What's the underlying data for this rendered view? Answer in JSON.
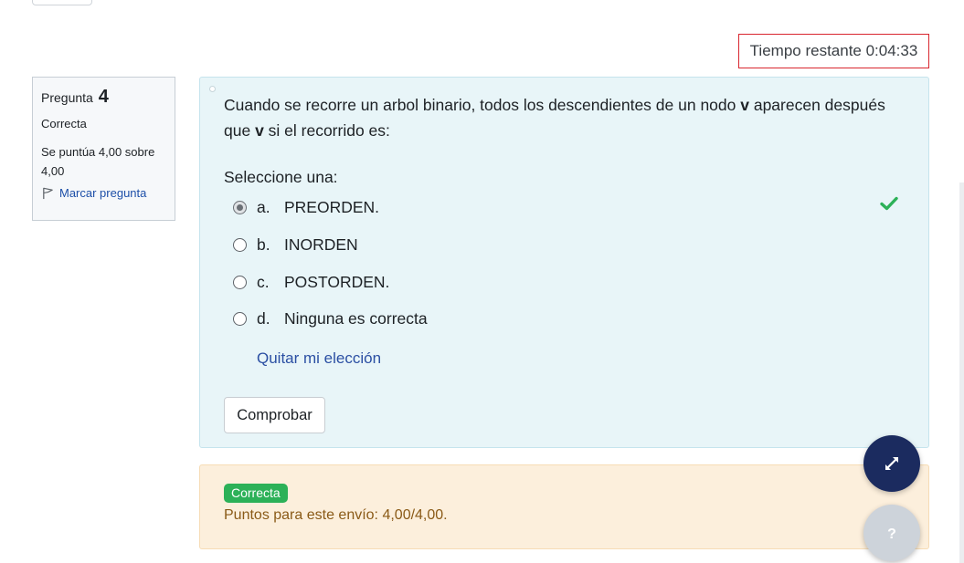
{
  "timer": {
    "label": "Tiempo restante 0:04:33"
  },
  "info": {
    "question_label": "Pregunta",
    "question_number": "4",
    "state": "Correcta",
    "grade_line1": "Se puntúa 4,00 sobre",
    "grade_line2": "4,00",
    "flag_label": "Marcar pregunta"
  },
  "question": {
    "text_part1": "Cuando se recorre un arbol binario, todos los descendientes de un nodo ",
    "text_bold1": "v",
    "text_part2": " aparecen después que ",
    "text_bold2": "v",
    "text_part3": " si el recorrido es:",
    "prompt": "Seleccione una:",
    "answers": [
      {
        "letter": "a.",
        "text": "PREORDEN.",
        "selected": true,
        "correct": true
      },
      {
        "letter": "b.",
        "text": "INORDEN",
        "selected": false
      },
      {
        "letter": "c.",
        "text": "POSTORDEN.",
        "selected": false
      },
      {
        "letter": "d.",
        "text": "Ninguna es correcta",
        "selected": false
      }
    ],
    "clear_label": "Quitar mi elección",
    "check_button": "Comprobar"
  },
  "outcome": {
    "badge": "Correcta",
    "points": "Puntos para este envío: 4,00/4,00."
  },
  "colors": {
    "correct_green": "#2cb158",
    "timer_border": "#d9262e",
    "fab_dark": "#1b2b5f"
  },
  "icons": {
    "flag": "flag-icon",
    "check": "check-icon",
    "expand": "expand-icon",
    "help": "help-icon"
  }
}
